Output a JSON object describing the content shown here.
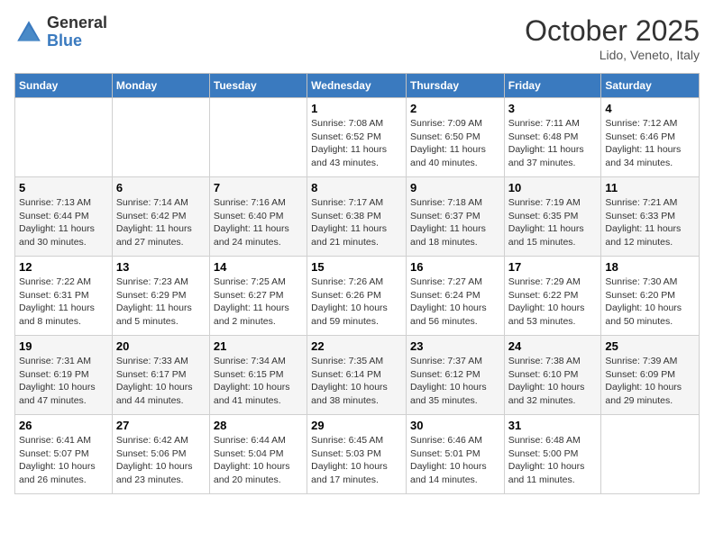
{
  "logo": {
    "general": "General",
    "blue": "Blue"
  },
  "header": {
    "month": "October 2025",
    "location": "Lido, Veneto, Italy"
  },
  "days_of_week": [
    "Sunday",
    "Monday",
    "Tuesday",
    "Wednesday",
    "Thursday",
    "Friday",
    "Saturday"
  ],
  "weeks": [
    [
      {
        "day": "",
        "info": ""
      },
      {
        "day": "",
        "info": ""
      },
      {
        "day": "",
        "info": ""
      },
      {
        "day": "1",
        "info": "Sunrise: 7:08 AM\nSunset: 6:52 PM\nDaylight: 11 hours and 43 minutes."
      },
      {
        "day": "2",
        "info": "Sunrise: 7:09 AM\nSunset: 6:50 PM\nDaylight: 11 hours and 40 minutes."
      },
      {
        "day": "3",
        "info": "Sunrise: 7:11 AM\nSunset: 6:48 PM\nDaylight: 11 hours and 37 minutes."
      },
      {
        "day": "4",
        "info": "Sunrise: 7:12 AM\nSunset: 6:46 PM\nDaylight: 11 hours and 34 minutes."
      }
    ],
    [
      {
        "day": "5",
        "info": "Sunrise: 7:13 AM\nSunset: 6:44 PM\nDaylight: 11 hours and 30 minutes."
      },
      {
        "day": "6",
        "info": "Sunrise: 7:14 AM\nSunset: 6:42 PM\nDaylight: 11 hours and 27 minutes."
      },
      {
        "day": "7",
        "info": "Sunrise: 7:16 AM\nSunset: 6:40 PM\nDaylight: 11 hours and 24 minutes."
      },
      {
        "day": "8",
        "info": "Sunrise: 7:17 AM\nSunset: 6:38 PM\nDaylight: 11 hours and 21 minutes."
      },
      {
        "day": "9",
        "info": "Sunrise: 7:18 AM\nSunset: 6:37 PM\nDaylight: 11 hours and 18 minutes."
      },
      {
        "day": "10",
        "info": "Sunrise: 7:19 AM\nSunset: 6:35 PM\nDaylight: 11 hours and 15 minutes."
      },
      {
        "day": "11",
        "info": "Sunrise: 7:21 AM\nSunset: 6:33 PM\nDaylight: 11 hours and 12 minutes."
      }
    ],
    [
      {
        "day": "12",
        "info": "Sunrise: 7:22 AM\nSunset: 6:31 PM\nDaylight: 11 hours and 8 minutes."
      },
      {
        "day": "13",
        "info": "Sunrise: 7:23 AM\nSunset: 6:29 PM\nDaylight: 11 hours and 5 minutes."
      },
      {
        "day": "14",
        "info": "Sunrise: 7:25 AM\nSunset: 6:27 PM\nDaylight: 11 hours and 2 minutes."
      },
      {
        "day": "15",
        "info": "Sunrise: 7:26 AM\nSunset: 6:26 PM\nDaylight: 10 hours and 59 minutes."
      },
      {
        "day": "16",
        "info": "Sunrise: 7:27 AM\nSunset: 6:24 PM\nDaylight: 10 hours and 56 minutes."
      },
      {
        "day": "17",
        "info": "Sunrise: 7:29 AM\nSunset: 6:22 PM\nDaylight: 10 hours and 53 minutes."
      },
      {
        "day": "18",
        "info": "Sunrise: 7:30 AM\nSunset: 6:20 PM\nDaylight: 10 hours and 50 minutes."
      }
    ],
    [
      {
        "day": "19",
        "info": "Sunrise: 7:31 AM\nSunset: 6:19 PM\nDaylight: 10 hours and 47 minutes."
      },
      {
        "day": "20",
        "info": "Sunrise: 7:33 AM\nSunset: 6:17 PM\nDaylight: 10 hours and 44 minutes."
      },
      {
        "day": "21",
        "info": "Sunrise: 7:34 AM\nSunset: 6:15 PM\nDaylight: 10 hours and 41 minutes."
      },
      {
        "day": "22",
        "info": "Sunrise: 7:35 AM\nSunset: 6:14 PM\nDaylight: 10 hours and 38 minutes."
      },
      {
        "day": "23",
        "info": "Sunrise: 7:37 AM\nSunset: 6:12 PM\nDaylight: 10 hours and 35 minutes."
      },
      {
        "day": "24",
        "info": "Sunrise: 7:38 AM\nSunset: 6:10 PM\nDaylight: 10 hours and 32 minutes."
      },
      {
        "day": "25",
        "info": "Sunrise: 7:39 AM\nSunset: 6:09 PM\nDaylight: 10 hours and 29 minutes."
      }
    ],
    [
      {
        "day": "26",
        "info": "Sunrise: 6:41 AM\nSunset: 5:07 PM\nDaylight: 10 hours and 26 minutes."
      },
      {
        "day": "27",
        "info": "Sunrise: 6:42 AM\nSunset: 5:06 PM\nDaylight: 10 hours and 23 minutes."
      },
      {
        "day": "28",
        "info": "Sunrise: 6:44 AM\nSunset: 5:04 PM\nDaylight: 10 hours and 20 minutes."
      },
      {
        "day": "29",
        "info": "Sunrise: 6:45 AM\nSunset: 5:03 PM\nDaylight: 10 hours and 17 minutes."
      },
      {
        "day": "30",
        "info": "Sunrise: 6:46 AM\nSunset: 5:01 PM\nDaylight: 10 hours and 14 minutes."
      },
      {
        "day": "31",
        "info": "Sunrise: 6:48 AM\nSunset: 5:00 PM\nDaylight: 10 hours and 11 minutes."
      },
      {
        "day": "",
        "info": ""
      }
    ]
  ]
}
